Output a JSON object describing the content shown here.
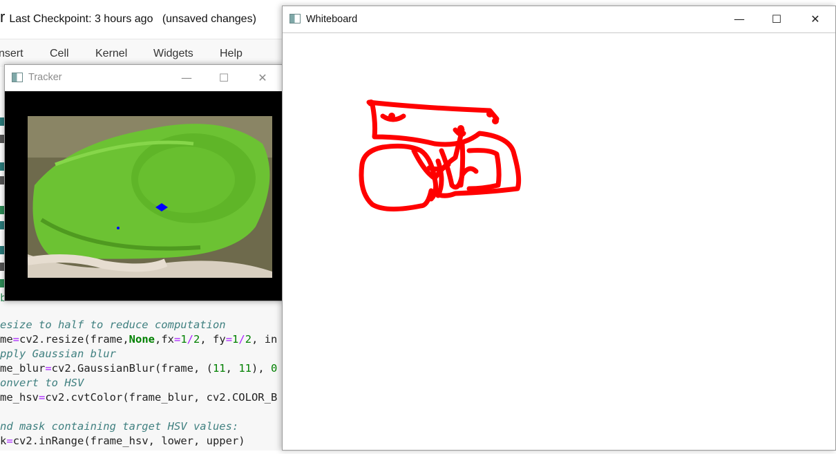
{
  "notebook": {
    "name_fragment": "r",
    "checkpoint": "Last Checkpoint: 3 hours ago",
    "status": "(unsaved changes)",
    "menu": [
      "nsert",
      "Cell",
      "Kernel",
      "Widgets",
      "Help"
    ],
    "code_lines": [
      {
        "kind": "plain",
        "text": "break"
      },
      {
        "kind": "comment",
        "text": "esize to half to reduce computation"
      },
      {
        "kind": "mixed",
        "parts": [
          [
            "",
            "me"
          ],
          [
            "op",
            "="
          ],
          [
            "",
            "cv2.resize(frame,"
          ],
          [
            "kw",
            "None"
          ],
          [
            "",
            ",fx"
          ],
          [
            "op",
            "="
          ],
          [
            "num",
            "1"
          ],
          [
            "op",
            "/"
          ],
          [
            "num",
            "2"
          ],
          [
            "",
            ", fy"
          ],
          [
            "op",
            "="
          ],
          [
            "num",
            "1"
          ],
          [
            "op",
            "/"
          ],
          [
            "num",
            "2"
          ],
          [
            "",
            ", in"
          ]
        ]
      },
      {
        "kind": "comment",
        "text": "pply Gaussian blur"
      },
      {
        "kind": "mixed",
        "parts": [
          [
            "",
            "me_blur"
          ],
          [
            "op",
            "="
          ],
          [
            "",
            "cv2.GaussianBlur(frame, ("
          ],
          [
            "num",
            "11"
          ],
          [
            "",
            ", "
          ],
          [
            "num",
            "11"
          ],
          [
            "",
            "), "
          ],
          [
            "num",
            "0"
          ]
        ]
      },
      {
        "kind": "comment",
        "text": "onvert to HSV"
      },
      {
        "kind": "mixed",
        "parts": [
          [
            "",
            "me_hsv"
          ],
          [
            "op",
            "="
          ],
          [
            "",
            "cv2.cvtColor(frame_blur, cv2.COLOR_B"
          ]
        ]
      },
      {
        "kind": "blank",
        "text": ""
      },
      {
        "kind": "comment",
        "text": "nd mask containing target HSV values:"
      },
      {
        "kind": "mixed",
        "parts": [
          [
            "",
            "k"
          ],
          [
            "op",
            "="
          ],
          [
            "",
            "cv2.inRange(frame_hsv, lower, upper)"
          ]
        ]
      }
    ]
  },
  "tracker": {
    "title": "Tracker",
    "icon": "opencv-window-icon",
    "controls": {
      "minimize": "—",
      "maximize": "☐",
      "close": "✕"
    }
  },
  "whiteboard": {
    "title": "Whiteboard",
    "icon": "opencv-window-icon",
    "controls": {
      "minimize": "—",
      "maximize": "☐",
      "close": "✕"
    },
    "stroke_color": "#ff0000"
  },
  "colors": {
    "object_green": "#6cc233",
    "marker_blue": "#0000ff",
    "stroke_red": "#ff0000"
  }
}
